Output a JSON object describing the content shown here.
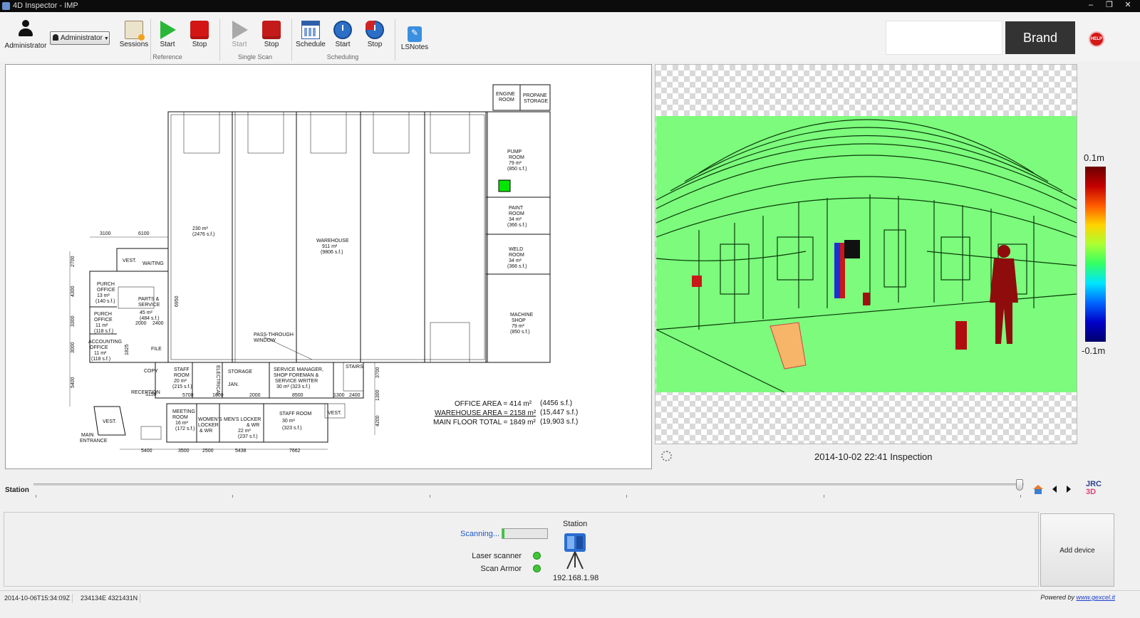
{
  "window": {
    "title": "4D Inspector - IMP",
    "controls": [
      "–",
      "❐",
      "✕"
    ]
  },
  "toolbar": {
    "user_label": "Administrator",
    "role_select": "Administrator",
    "sessions": "Sessions",
    "reference": {
      "group": "Reference",
      "start": "Start",
      "stop": "Stop"
    },
    "single_scan": {
      "group": "Single Scan",
      "start": "Start",
      "stop": "Stop"
    },
    "scheduling": {
      "group": "Scheduling",
      "schedule": "Schedule",
      "start": "Start",
      "stop": "Stop"
    },
    "lsnotes": "LSNotes",
    "brand": "Brand",
    "help": "HELP"
  },
  "floorplan": {
    "rooms": {
      "engine": [
        "ENGINE",
        "ROOM"
      ],
      "propane": [
        "PROPANE",
        "STORAGE"
      ],
      "pump": [
        "PUMP",
        "ROOM",
        "79 m²",
        "(850 s.f.)"
      ],
      "paint": [
        "PAINT",
        "ROOM",
        "34 m²",
        "(366 s.f.)"
      ],
      "weld": [
        "WELD",
        "ROOM",
        "34 m²",
        "(366 s.f.)"
      ],
      "machine": [
        "MACHINE",
        "SHOP",
        "79 m²",
        "(850 s.f.)"
      ],
      "warehouse": [
        "WAREHOUSE",
        "911 m²",
        "(9806 s.f.)"
      ],
      "area230": [
        "230 m²",
        "(2476 s.f.)"
      ],
      "waiting": "WAITING",
      "vest_top": "VEST.",
      "purch1": [
        "PURCH",
        "OFFICE",
        "13 m²",
        "(140 s.f.)"
      ],
      "parts": [
        "PARTS &",
        "SERVICE",
        "45 m²",
        "(484 s.f.)"
      ],
      "purch2": [
        "PURCH",
        "OFFICE",
        "11 m²",
        "(118 s.f.)"
      ],
      "accounting": [
        "ACCOUNTING",
        "OFFICE",
        "11 m²",
        "(118 s.f.)"
      ],
      "file": "FILE",
      "copy": "COPY",
      "reception": "RECEPTION",
      "staff1": [
        "STAFF",
        "ROOM",
        "20 m²",
        "(215 s.f.)"
      ],
      "electrical": "ELECTRICAL",
      "storage": "STORAGE",
      "jan": "JAN.",
      "service_mgr": [
        "SERVICE MANAGER,",
        "SHOP FOREMAN &",
        "SERVICE WRITER",
        "30 m²  (323 s.f.)"
      ],
      "stairs": "STAIRS",
      "pass_through": [
        "PASS-THROUGH",
        "WINDOW"
      ],
      "meeting": [
        "MEETING",
        "ROOM",
        "16 m²",
        "(172 s.f.)"
      ],
      "womens": [
        "WOMEN'S",
        "LOCKER",
        "& WR"
      ],
      "mens": [
        "MEN'S LOCKER",
        "& WR",
        "22 m²",
        "(237 s.f.)"
      ],
      "staff2": [
        "STAFF ROOM",
        "30 m²",
        "(323 s.f.)"
      ],
      "vest_right": "VEST.",
      "vest_bottom": "VEST.",
      "main_entrance": [
        "MAIN",
        "ENTRANCE"
      ]
    },
    "dims": {
      "top": [
        "3100",
        "6100"
      ],
      "left": [
        "2700",
        "4300",
        "3300",
        "3000",
        "5400"
      ],
      "inner": [
        "6950",
        "1825",
        "2000",
        "2400",
        "3150",
        "5700",
        "1600",
        "2000",
        "8500",
        "1300",
        "2400",
        "3700",
        "1300",
        "4200"
      ],
      "bottom": [
        "5400",
        "3500",
        "2500",
        "5438",
        "7662"
      ]
    },
    "area_table": [
      {
        "label": "OFFICE AREA = 414 m²",
        "sf": "(4456 s.f.)"
      },
      {
        "label": "WAREHOUSE AREA = 2158 m²",
        "sf": "(15,447 s.f.)"
      },
      {
        "label": "MAIN FLOOR TOTAL = 1849 m²",
        "sf": "(19,903 s.f.)"
      }
    ],
    "marker_color": "#00e600"
  },
  "scan": {
    "legend_max": "0.1m",
    "legend_min": "-0.1m",
    "caption": "2014-10-02 22:41  Inspection"
  },
  "station": {
    "label": "Station"
  },
  "devices": {
    "scanning": "Scanning...",
    "progress": 0.04,
    "laser_scanner": "Laser scanner",
    "scan_armor": "Scan Armor",
    "station_title": "Station",
    "station_ip": "192.168.1.98",
    "add_device": "Add device",
    "status_color": "#3ec834"
  },
  "statusbar": {
    "timestamp": "2014-10-06T15:34:09Z",
    "coords": "234134E 4321431N",
    "powered_by": "Powered by",
    "powered_link": "www.gexcel.it"
  }
}
